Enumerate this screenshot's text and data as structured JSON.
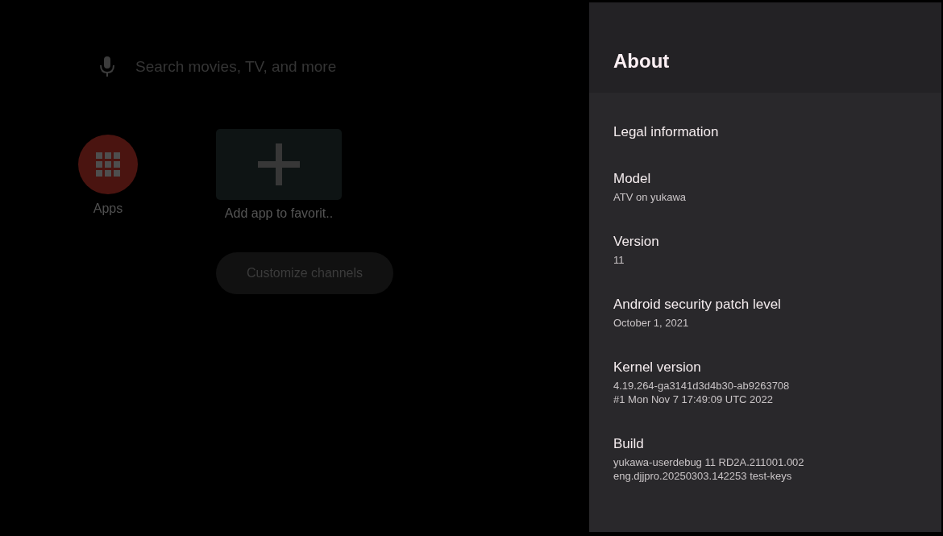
{
  "home": {
    "search": {
      "placeholder": "Search movies, TV, and more"
    },
    "apps": {
      "label": "Apps"
    },
    "add_favorite": {
      "label": "Add app to favorit.."
    },
    "customize_button": {
      "label": "Customize channels"
    }
  },
  "panel": {
    "title": "About",
    "items": [
      {
        "title": "Legal information"
      },
      {
        "title": "Model",
        "summary": [
          "ATV on yukawa"
        ]
      },
      {
        "title": "Version",
        "summary": [
          "11"
        ]
      },
      {
        "title": "Android security patch level",
        "summary": [
          "October 1, 2021"
        ]
      },
      {
        "title": "Kernel version",
        "summary": [
          "4.19.264-ga3141d3d4b30-ab9263708",
          "#1 Mon Nov 7 17:49:09 UTC 2022"
        ]
      },
      {
        "title": "Build",
        "summary": [
          "yukawa-userdebug 11 RD2A.211001.002",
          "eng.djjpro.20250303.142253 test-keys"
        ]
      }
    ]
  }
}
